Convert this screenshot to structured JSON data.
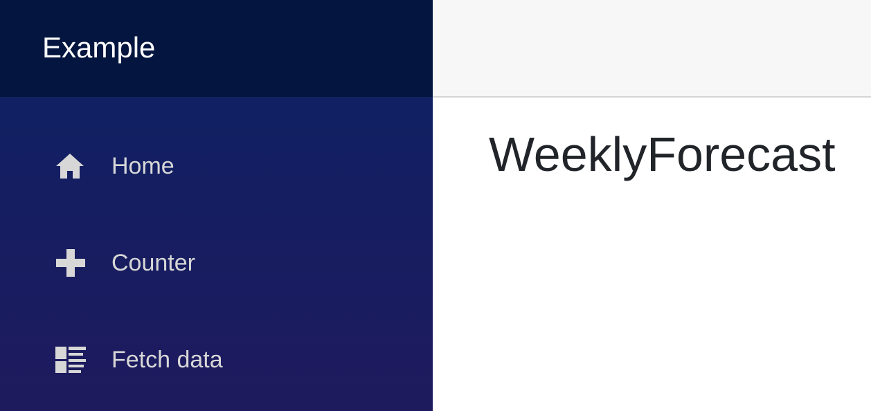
{
  "brand": {
    "title": "Example"
  },
  "sidebar": {
    "items": [
      {
        "label": "Home",
        "icon": "home-icon"
      },
      {
        "label": "Counter",
        "icon": "plus-icon"
      },
      {
        "label": "Fetch data",
        "icon": "list-rich-icon"
      }
    ]
  },
  "main": {
    "title": "WeeklyForecast"
  },
  "colors": {
    "brand_bar": "#04163f",
    "sidebar_top": "#0b2264",
    "sidebar_bottom": "#1f1a5e",
    "nav_text": "#d7d7d7",
    "top_row": "#f7f7f7",
    "title_text": "#212529"
  }
}
